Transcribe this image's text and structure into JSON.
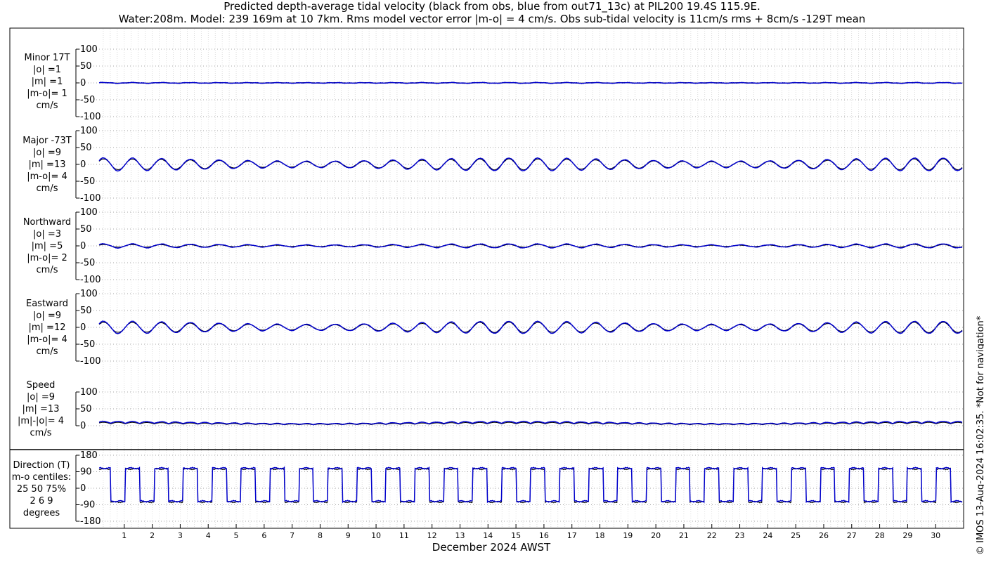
{
  "title_line1": "Predicted depth-average tidal velocity (black from obs, blue from out71_13c) at PIL200 19.4S 115.9E.",
  "title_line2": "Water:208m. Model: 239 169m at 10 7km. Rms model vector error |m-o| = 4 cm/s. Obs sub-tidal velocity is 11cm/s rms + 8cm/s -129T mean",
  "copyright": "© IMOS 13-Aug-2024 16:02:35. *Not for navigation*",
  "colors": {
    "obs": "#000000",
    "model": "#0000cc"
  },
  "chart_data": {
    "type": "line",
    "xlabel": "December 2024 AWST",
    "x_ticks": [
      "1",
      "2",
      "3",
      "4",
      "5",
      "6",
      "7",
      "8",
      "9",
      "10",
      "11",
      "12",
      "13",
      "14",
      "15",
      "16",
      "17",
      "18",
      "19",
      "20",
      "21",
      "22",
      "23",
      "24",
      "25",
      "26",
      "27",
      "28",
      "29",
      "30"
    ],
    "xlim": [
      0,
      31
    ],
    "grid": true,
    "series_names": [
      "obs",
      "out71_13c"
    ],
    "panels": [
      {
        "key": "minor",
        "label_lines": [
          "Minor 17T",
          "|o| =1",
          "|m| =1",
          "|m-o|= 1",
          "cm/s"
        ],
        "ylim": [
          -100,
          100
        ],
        "yticks": [
          "100",
          "50",
          "0",
          "-50",
          "-100"
        ],
        "yvals": [
          100,
          50,
          0,
          -50,
          -100
        ],
        "kind": "velocity",
        "obs_amplitude": 1,
        "model_amplitude": 1
      },
      {
        "key": "major",
        "label_lines": [
          "Major -73T",
          "|o| =9",
          "|m| =13",
          "|m-o|= 4",
          "cm/s"
        ],
        "ylim": [
          -100,
          100
        ],
        "yticks": [
          "100",
          "50",
          "0",
          "-50",
          "-100"
        ],
        "yvals": [
          100,
          50,
          0,
          -50,
          -100
        ],
        "kind": "velocity",
        "obs_amplitude": 16,
        "model_amplitude": 19
      },
      {
        "key": "northward",
        "label_lines": [
          "Northward",
          "|o| =3",
          "|m| =5",
          "|m-o|= 2",
          "cm/s"
        ],
        "ylim": [
          -100,
          100
        ],
        "yticks": [
          "100",
          "50",
          "0",
          "-50",
          "-100"
        ],
        "yvals": [
          100,
          50,
          0,
          -50,
          -100
        ],
        "kind": "velocity",
        "obs_amplitude": 4,
        "model_amplitude": 6
      },
      {
        "key": "eastward",
        "label_lines": [
          "Eastward",
          "|o| =9",
          "|m| =12",
          "|m-o|= 4",
          "cm/s"
        ],
        "ylim": [
          -100,
          100
        ],
        "yticks": [
          "100",
          "50",
          "0",
          "-50",
          "-100"
        ],
        "yvals": [
          100,
          50,
          0,
          -50,
          -100
        ],
        "kind": "velocity",
        "obs_amplitude": 15,
        "model_amplitude": 18
      },
      {
        "key": "speed",
        "label_lines": [
          "Speed",
          "|o| =9",
          "|m| =13",
          "|m|-|o|= 4",
          "cm/s"
        ],
        "ylim": [
          0,
          100
        ],
        "yticks": [
          "100",
          "50",
          "0"
        ],
        "yvals": [
          100,
          50,
          0
        ],
        "kind": "speed",
        "obs_amplitude": 10,
        "model_amplitude": 13
      },
      {
        "key": "direction",
        "label_lines": [
          "Direction (T)",
          "m-o centiles:",
          "25  50  75%",
          "2   6   9",
          "degrees"
        ],
        "ylim": [
          -180,
          180
        ],
        "yticks": [
          "180",
          "90",
          "0",
          "-90",
          "-180"
        ],
        "yvals": [
          180,
          90,
          0,
          -90,
          -180
        ],
        "kind": "direction",
        "high_deg": 107,
        "low_deg": -73
      }
    ]
  }
}
